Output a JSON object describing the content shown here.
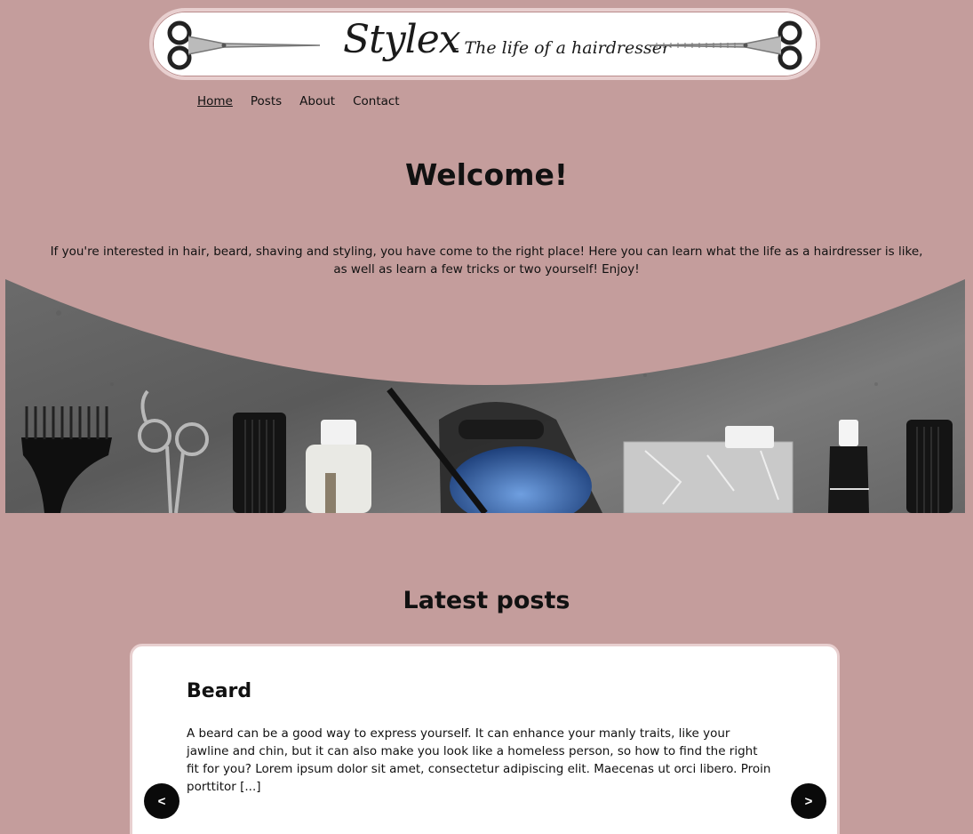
{
  "banner": {
    "brand": "Stylex",
    "tagline": "- The life of a hairdresser"
  },
  "nav": {
    "items": [
      {
        "label": "Home",
        "active": true
      },
      {
        "label": "Posts",
        "active": false
      },
      {
        "label": "About",
        "active": false
      },
      {
        "label": "Contact",
        "active": false
      }
    ]
  },
  "main": {
    "title": "Welcome!",
    "intro": "If you're interested in hair, beard, shaving and styling, you have come to the right place! Here you can learn what the life as a hairdresser is like, as well as learn a few tricks or two yourself! Enjoy!"
  },
  "latest": {
    "heading": "Latest posts",
    "post": {
      "title": "Beard",
      "excerpt": "A beard can be a good way to express yourself. It can enhance your manly traits, like your jawline and chin, but it can also make you look like a homeless person, so how to find the right fit for you? Lorem ipsum dolor sit amet, consectetur adipiscing elit. Maecenas ut orci libero. Proin porttitor [...]"
    },
    "prev_label": "<",
    "next_label": ">"
  },
  "colors": {
    "page_background": "#c49d9c",
    "card_border": "#e8cfcf",
    "arrow_background": "#0a0a0a"
  }
}
